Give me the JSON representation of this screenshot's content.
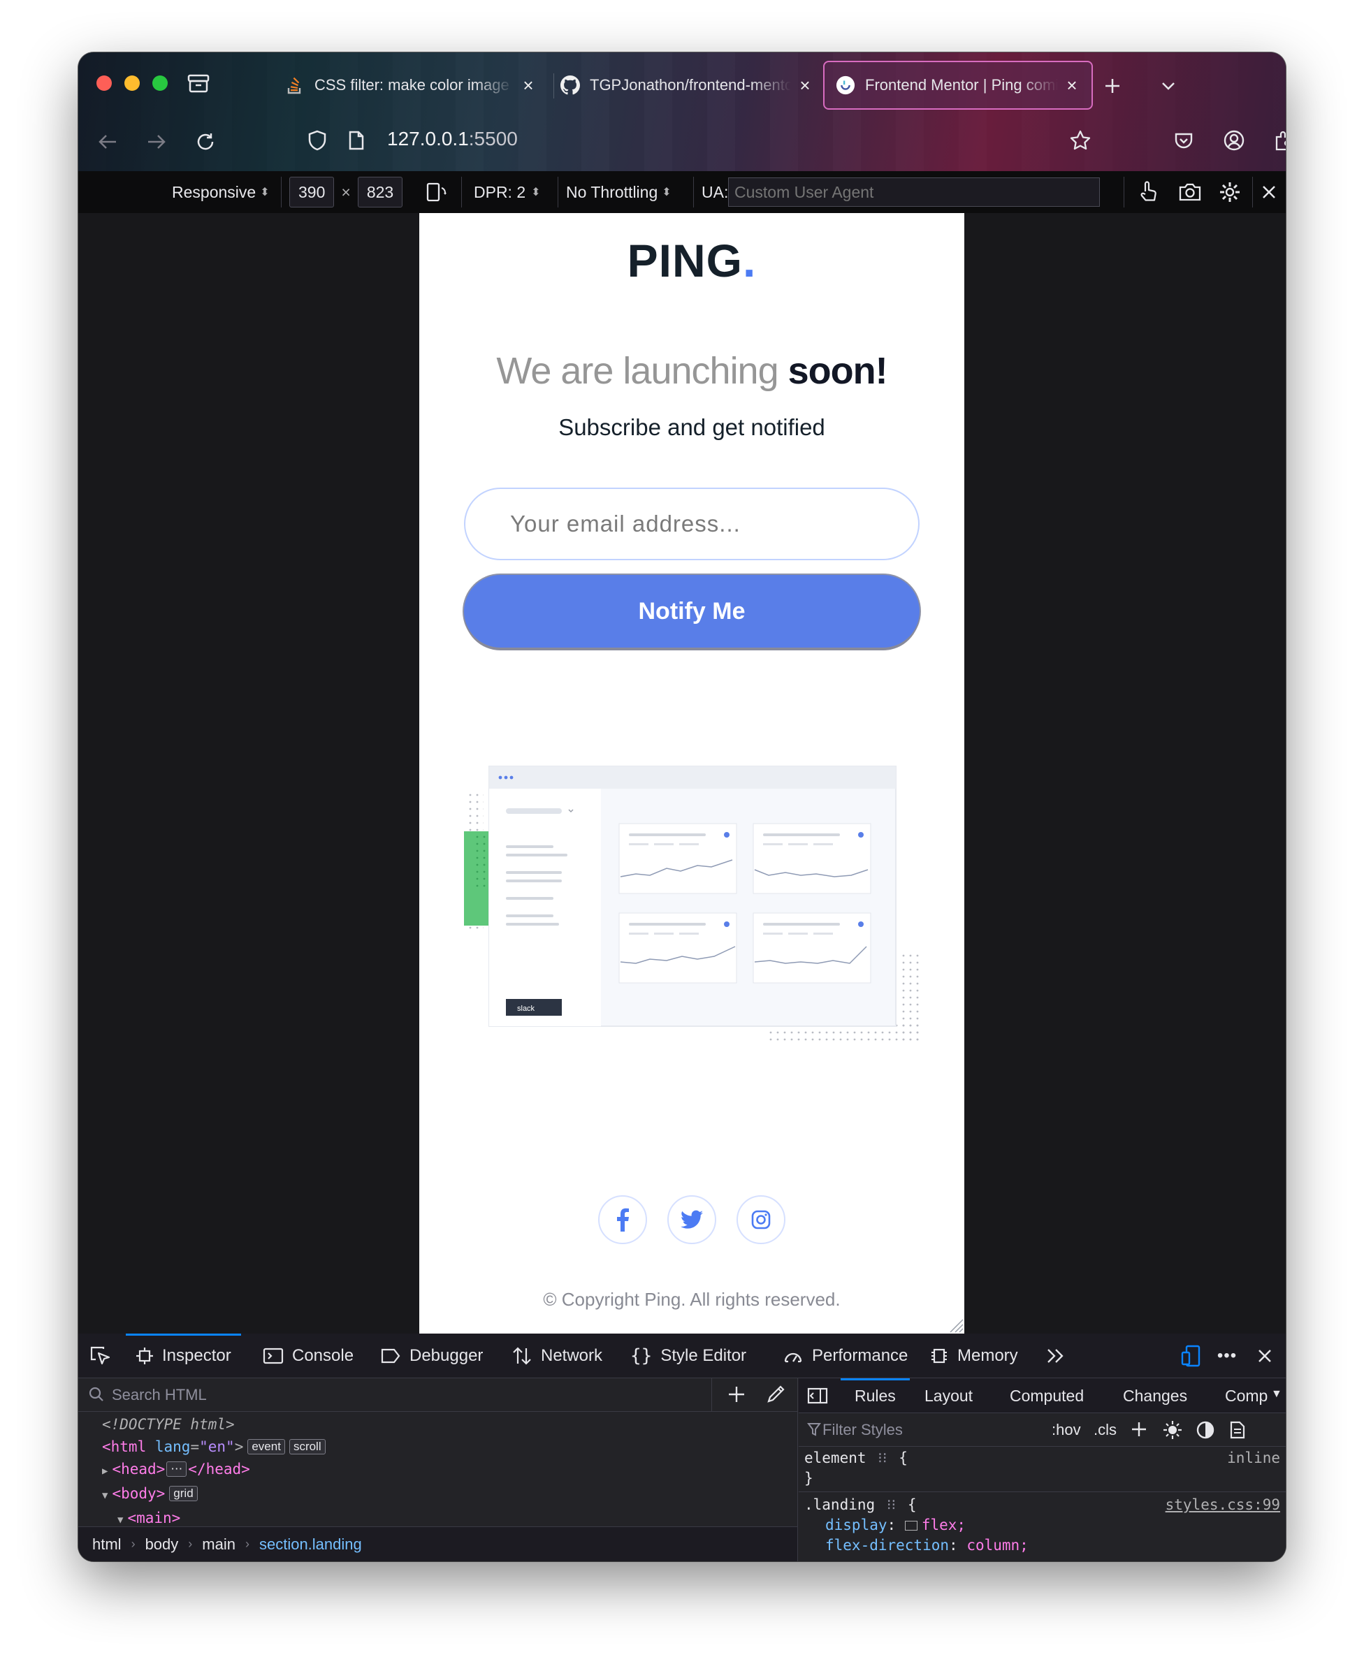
{
  "browser": {
    "tabs": [
      {
        "title": "CSS filter: make color image",
        "favicon": "stackoverflow-icon"
      },
      {
        "title": "TGPJonathon/frontend-mentor",
        "favicon": "github-icon"
      },
      {
        "title": "Frontend Mentor | Ping coming soon",
        "favicon": "frontend-mentor-icon",
        "active": true
      }
    ],
    "url_host": "127.0.0.1",
    "url_port": ":5500"
  },
  "rdm": {
    "device": "Responsive",
    "width": "390",
    "times": "×",
    "height": "823",
    "dpr": "DPR: 2",
    "throttling": "No Throttling",
    "ua_label": "UA:",
    "ua_placeholder": "Custom User Agent"
  },
  "page": {
    "logo_text": "PING",
    "logo_dot": ".",
    "headline_light": "We are launching ",
    "headline_bold": "soon!",
    "subhead": "Subscribe and get notified",
    "email_placeholder": "Your email address...",
    "notify_label": "Notify Me",
    "copyright": "© Copyright Ping. All rights reserved.",
    "illus_badge": "slack",
    "colors": {
      "accent": "#4c7bf3",
      "button": "#597ee8",
      "dark": "#15202a",
      "gray": "#969696"
    }
  },
  "devtools": {
    "tabs": [
      "Inspector",
      "Console",
      "Debugger",
      "Network",
      "Style Editor",
      "Performance",
      "Memory"
    ],
    "search_placeholder": "Search HTML",
    "tree": {
      "doctype": "<!DOCTYPE html>",
      "html_open": "<html",
      "lang_attr": "lang",
      "lang_val": "\"en\"",
      "html_close": ">",
      "badge_event": "event",
      "badge_scroll": "scroll",
      "head": "<head>",
      "head_close": "</head>",
      "ellipsis": "⋯",
      "body": "<body>",
      "badge_grid": "grid",
      "main": "<main>"
    },
    "breadcrumbs": [
      "html",
      "body",
      "main",
      "section.landing"
    ],
    "rules_tabs": [
      "Rules",
      "Layout",
      "Computed",
      "Changes",
      "Comp"
    ],
    "filter_placeholder": "Filter Styles",
    "hov": ":hov",
    "cls": ".cls",
    "css": {
      "element_selector": "element",
      "element_origin": "inline",
      "open_brace": "{",
      "close_brace": "}",
      "landing_selector": ".landing",
      "landing_source": "styles.css:99",
      "p1_name": "display",
      "p1_val": "flex;",
      "p2_name": "flex-direction",
      "p2_val": "column;"
    }
  }
}
